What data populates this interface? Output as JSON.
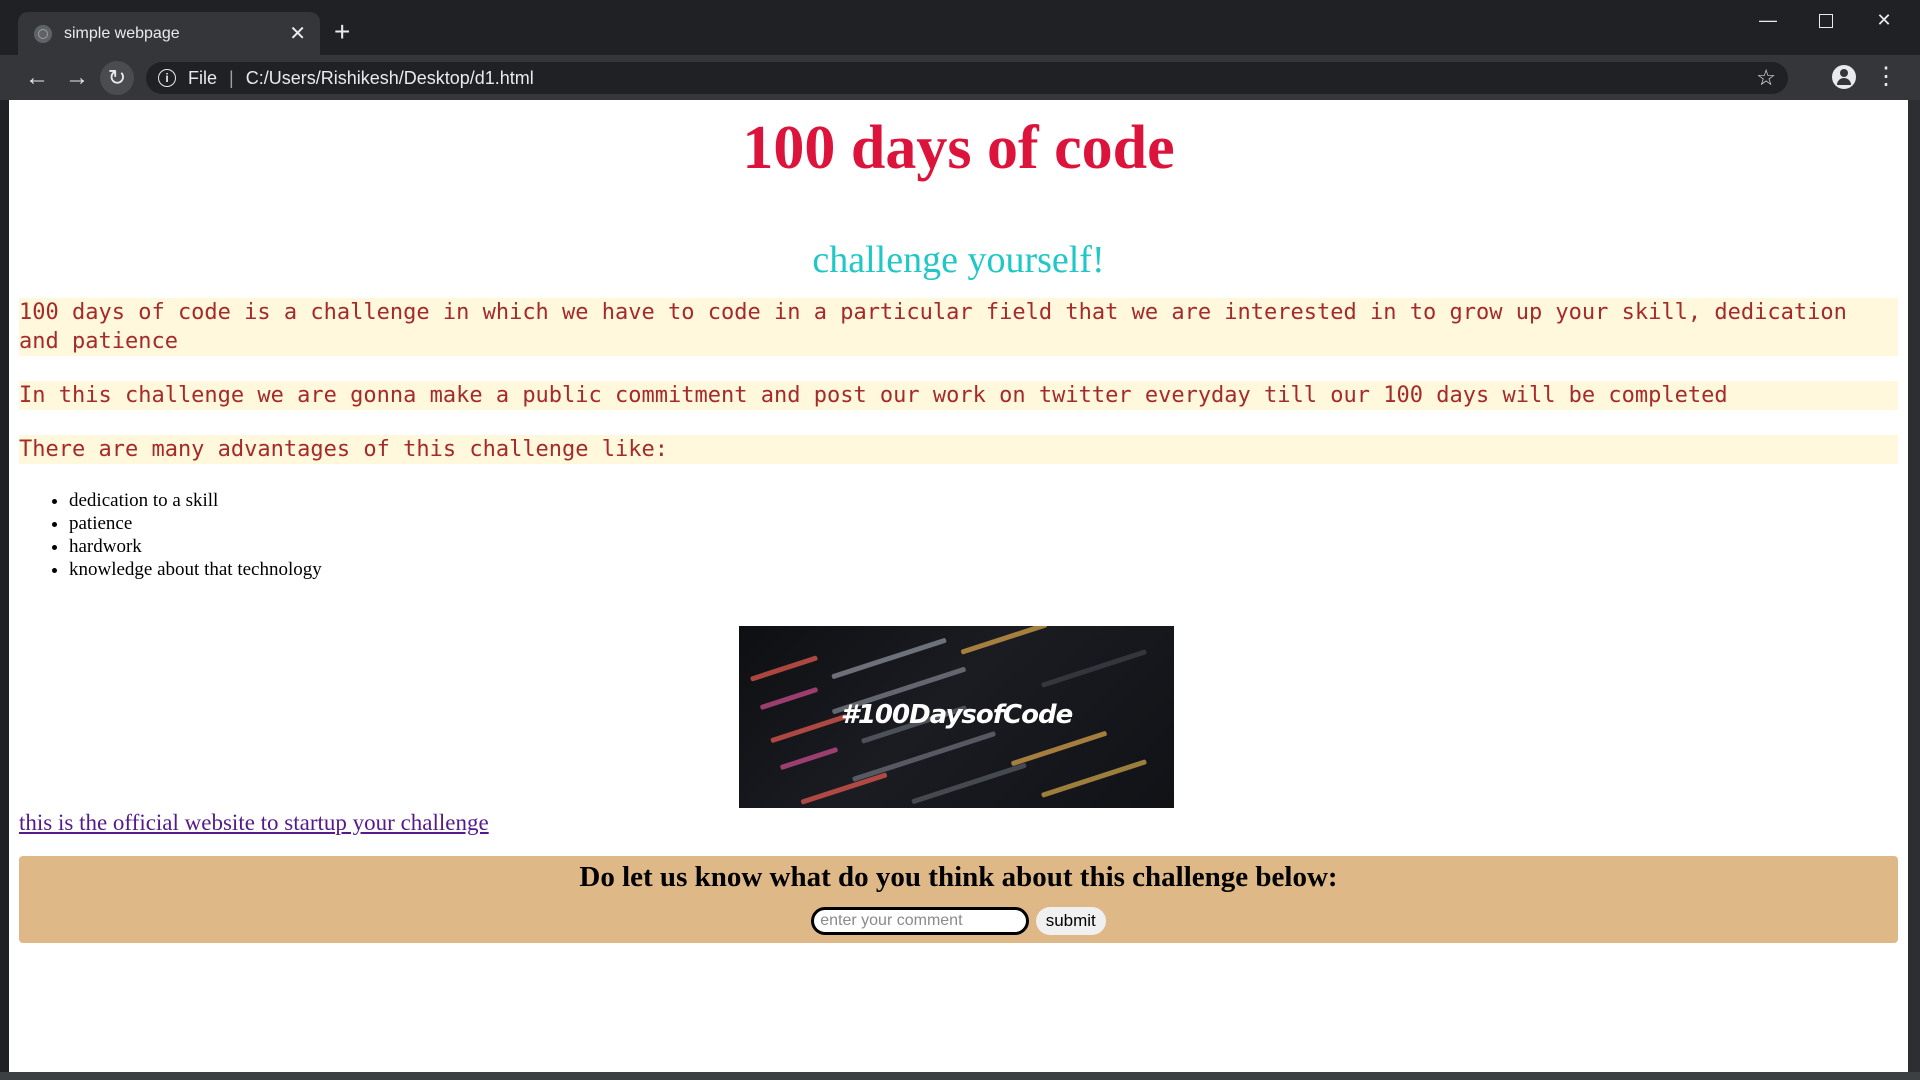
{
  "browser": {
    "tab_title": "simple webpage",
    "tab_close": "✕",
    "new_tab": "+",
    "address_scheme": "File",
    "address_separator": "|",
    "address_path": "C:/Users/Rishikesh/Desktop/d1.html",
    "win_minimize": "—",
    "win_close": "✕"
  },
  "page": {
    "title": "100 days of code",
    "subtitle": "challenge yourself!",
    "paragraphs": [
      "100 days of code is a challenge in which we have to code in a particular field that we are interested in to grow up your skill, dedication and patience",
      "In this challenge we are gonna make a public commitment and post our work on twitter everyday till our 100 days will be completed",
      "There are many advantages of this challenge like:"
    ],
    "advantages": [
      "dedication to a skill",
      "patience",
      "hardwork",
      "knowledge about that technology"
    ],
    "image_text": "#100DaysofCode",
    "link_text": "this is the official website to startup your challenge",
    "comment_heading": "Do let us know what do you think about this challenge below:",
    "comment_placeholder": "enter your comment",
    "submit_label": "submit"
  },
  "colors": {
    "title": "#dc143c",
    "subtitle": "#1fc7c7",
    "paragraph_text": "#a52a2a",
    "paragraph_bg": "#fff8dc",
    "comment_bg": "#deb887",
    "link": "#551a8b"
  },
  "icons": {
    "back": "arrow-left-icon",
    "forward": "arrow-right-icon",
    "reload": "reload-icon",
    "info": "info-icon",
    "bookmark": "star-icon",
    "profile": "account-icon",
    "menu": "kebab-menu-icon"
  }
}
